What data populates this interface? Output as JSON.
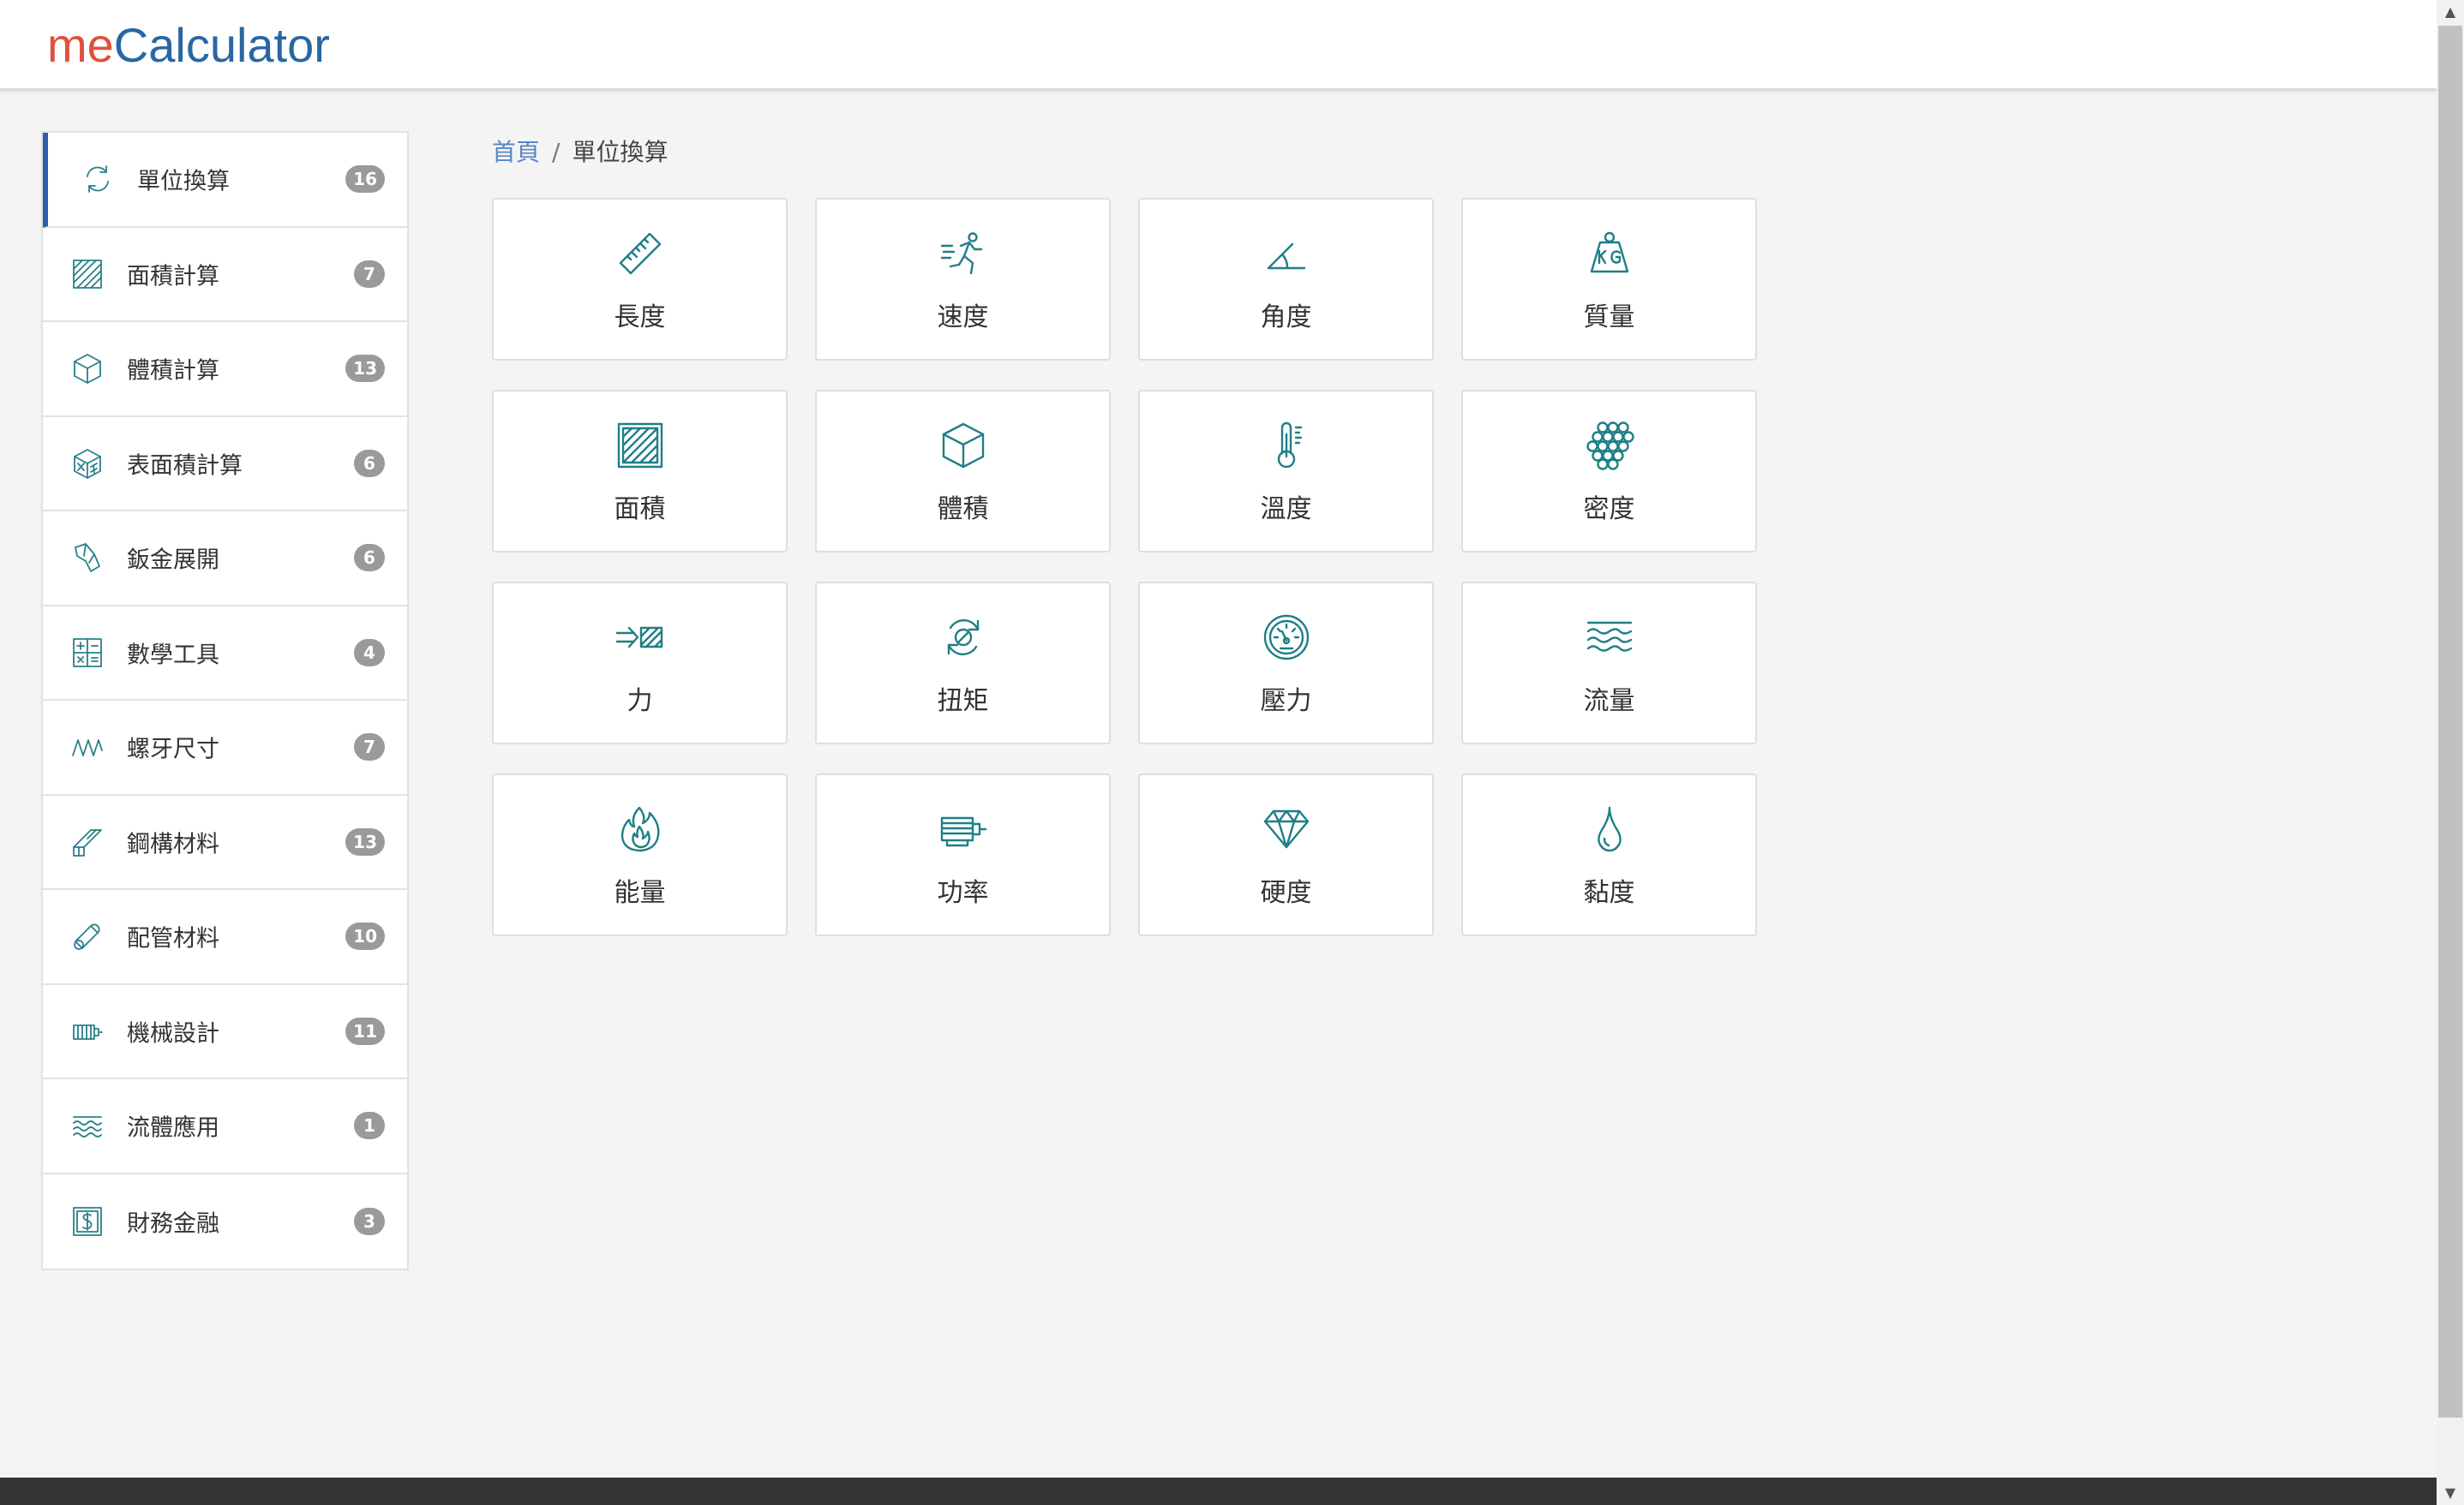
{
  "app": {
    "logo_me": "me",
    "logo_calc": "Calculator"
  },
  "sidebar": {
    "items": [
      {
        "label": "單位換算",
        "badge": "16",
        "icon": "convert-icon",
        "active": true
      },
      {
        "label": "面積計算",
        "badge": "7",
        "icon": "area-icon"
      },
      {
        "label": "體積計算",
        "badge": "13",
        "icon": "cube-icon"
      },
      {
        "label": "表面積計算",
        "badge": "6",
        "icon": "surface-cube-icon"
      },
      {
        "label": "鈑金展開",
        "badge": "6",
        "icon": "sheet-metal-icon"
      },
      {
        "label": "數學工具",
        "badge": "4",
        "icon": "calculator-icon"
      },
      {
        "label": "螺牙尺寸",
        "badge": "7",
        "icon": "thread-icon"
      },
      {
        "label": "鋼構材料",
        "badge": "13",
        "icon": "steel-beam-icon"
      },
      {
        "label": "配管材料",
        "badge": "10",
        "icon": "pipe-icon"
      },
      {
        "label": "機械設計",
        "badge": "11",
        "icon": "motor-icon"
      },
      {
        "label": "流體應用",
        "badge": "1",
        "icon": "waves-icon"
      },
      {
        "label": "財務金融",
        "badge": "3",
        "icon": "finance-icon"
      }
    ]
  },
  "breadcrumb": {
    "home": "首頁",
    "separator": "/",
    "current": "單位換算"
  },
  "tiles": [
    {
      "label": "長度",
      "icon": "ruler-icon"
    },
    {
      "label": "速度",
      "icon": "runner-icon"
    },
    {
      "label": "角度",
      "icon": "angle-icon"
    },
    {
      "label": "質量",
      "icon": "weight-kg-icon"
    },
    {
      "label": "面積",
      "icon": "area-icon"
    },
    {
      "label": "體積",
      "icon": "cube-icon"
    },
    {
      "label": "溫度",
      "icon": "thermometer-icon"
    },
    {
      "label": "密度",
      "icon": "density-icon"
    },
    {
      "label": "力",
      "icon": "force-icon"
    },
    {
      "label": "扭矩",
      "icon": "torque-icon"
    },
    {
      "label": "壓力",
      "icon": "gauge-icon"
    },
    {
      "label": "流量",
      "icon": "waves-icon"
    },
    {
      "label": "能量",
      "icon": "flame-icon"
    },
    {
      "label": "功率",
      "icon": "motor-icon"
    },
    {
      "label": "硬度",
      "icon": "diamond-icon"
    },
    {
      "label": "黏度",
      "icon": "drop-icon"
    }
  ],
  "colors": {
    "accent": "#2b5fa6",
    "icon": "#1e7f86",
    "logo_me": "#e0513a",
    "logo_calc": "#2867a3",
    "badge": "#9a9a9a"
  }
}
